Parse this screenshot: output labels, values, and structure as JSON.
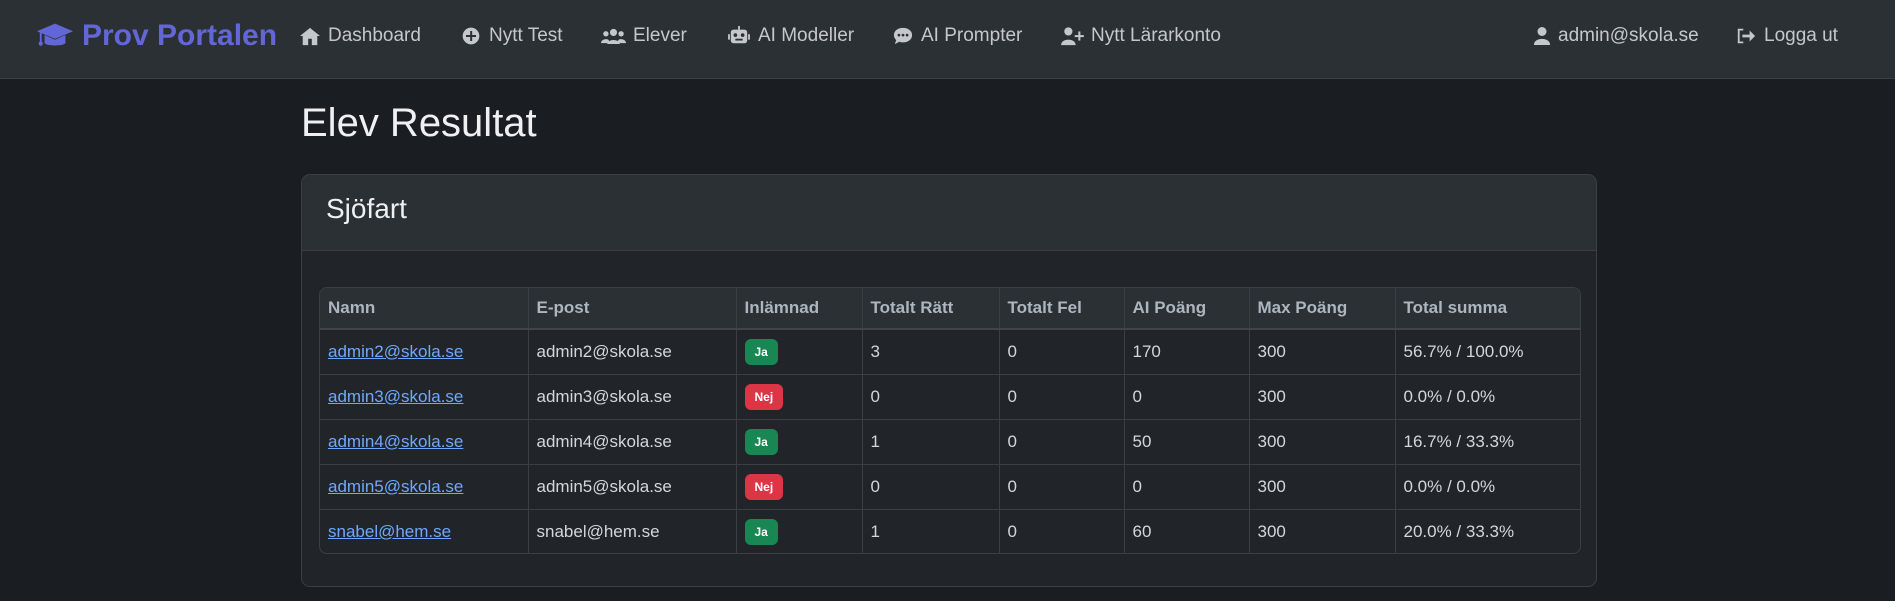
{
  "nav": {
    "brand": "Prov Portalen",
    "items": [
      {
        "label": "Dashboard",
        "icon": "home-icon"
      },
      {
        "label": "Nytt Test",
        "icon": "plus-circle-icon"
      },
      {
        "label": "Elever",
        "icon": "users-icon"
      },
      {
        "label": "AI Modeller",
        "icon": "robot-icon"
      },
      {
        "label": "AI Prompter",
        "icon": "comment-dots-icon"
      },
      {
        "label": "Nytt Lärarkonto",
        "icon": "user-plus-icon"
      }
    ],
    "user": "admin@skola.se",
    "logout": "Logga ut"
  },
  "page": {
    "title": "Elev Resultat",
    "card_title": "Sjöfart"
  },
  "table": {
    "headers": [
      "Namn",
      "E-post",
      "Inlämnad",
      "Totalt Rätt",
      "Totalt Fel",
      "AI Poäng",
      "Max Poäng",
      "Total summa"
    ],
    "rows": [
      {
        "name": "admin2@skola.se",
        "email": "admin2@skola.se",
        "submitted": "Ja",
        "correct": "3",
        "wrong": "0",
        "ai_points": "170",
        "max_points": "300",
        "total": "56.7% / 100.0%"
      },
      {
        "name": "admin3@skola.se",
        "email": "admin3@skola.se",
        "submitted": "Nej",
        "correct": "0",
        "wrong": "0",
        "ai_points": "0",
        "max_points": "300",
        "total": "0.0% / 0.0%"
      },
      {
        "name": "admin4@skola.se",
        "email": "admin4@skola.se",
        "submitted": "Ja",
        "correct": "1",
        "wrong": "0",
        "ai_points": "50",
        "max_points": "300",
        "total": "16.7% / 33.3%"
      },
      {
        "name": "admin5@skola.se",
        "email": "admin5@skola.se",
        "submitted": "Nej",
        "correct": "0",
        "wrong": "0",
        "ai_points": "0",
        "max_points": "300",
        "total": "0.0% / 0.0%"
      },
      {
        "name": "snabel@hem.se",
        "email": "snabel@hem.se",
        "submitted": "Ja",
        "correct": "1",
        "wrong": "0",
        "ai_points": "60",
        "max_points": "300",
        "total": "20.0% / 33.3%"
      }
    ]
  },
  "colors": {
    "brand": "#6366d6",
    "badge_yes": "#198754",
    "badge_no": "#dc3545",
    "link": "#6ea8fe"
  }
}
